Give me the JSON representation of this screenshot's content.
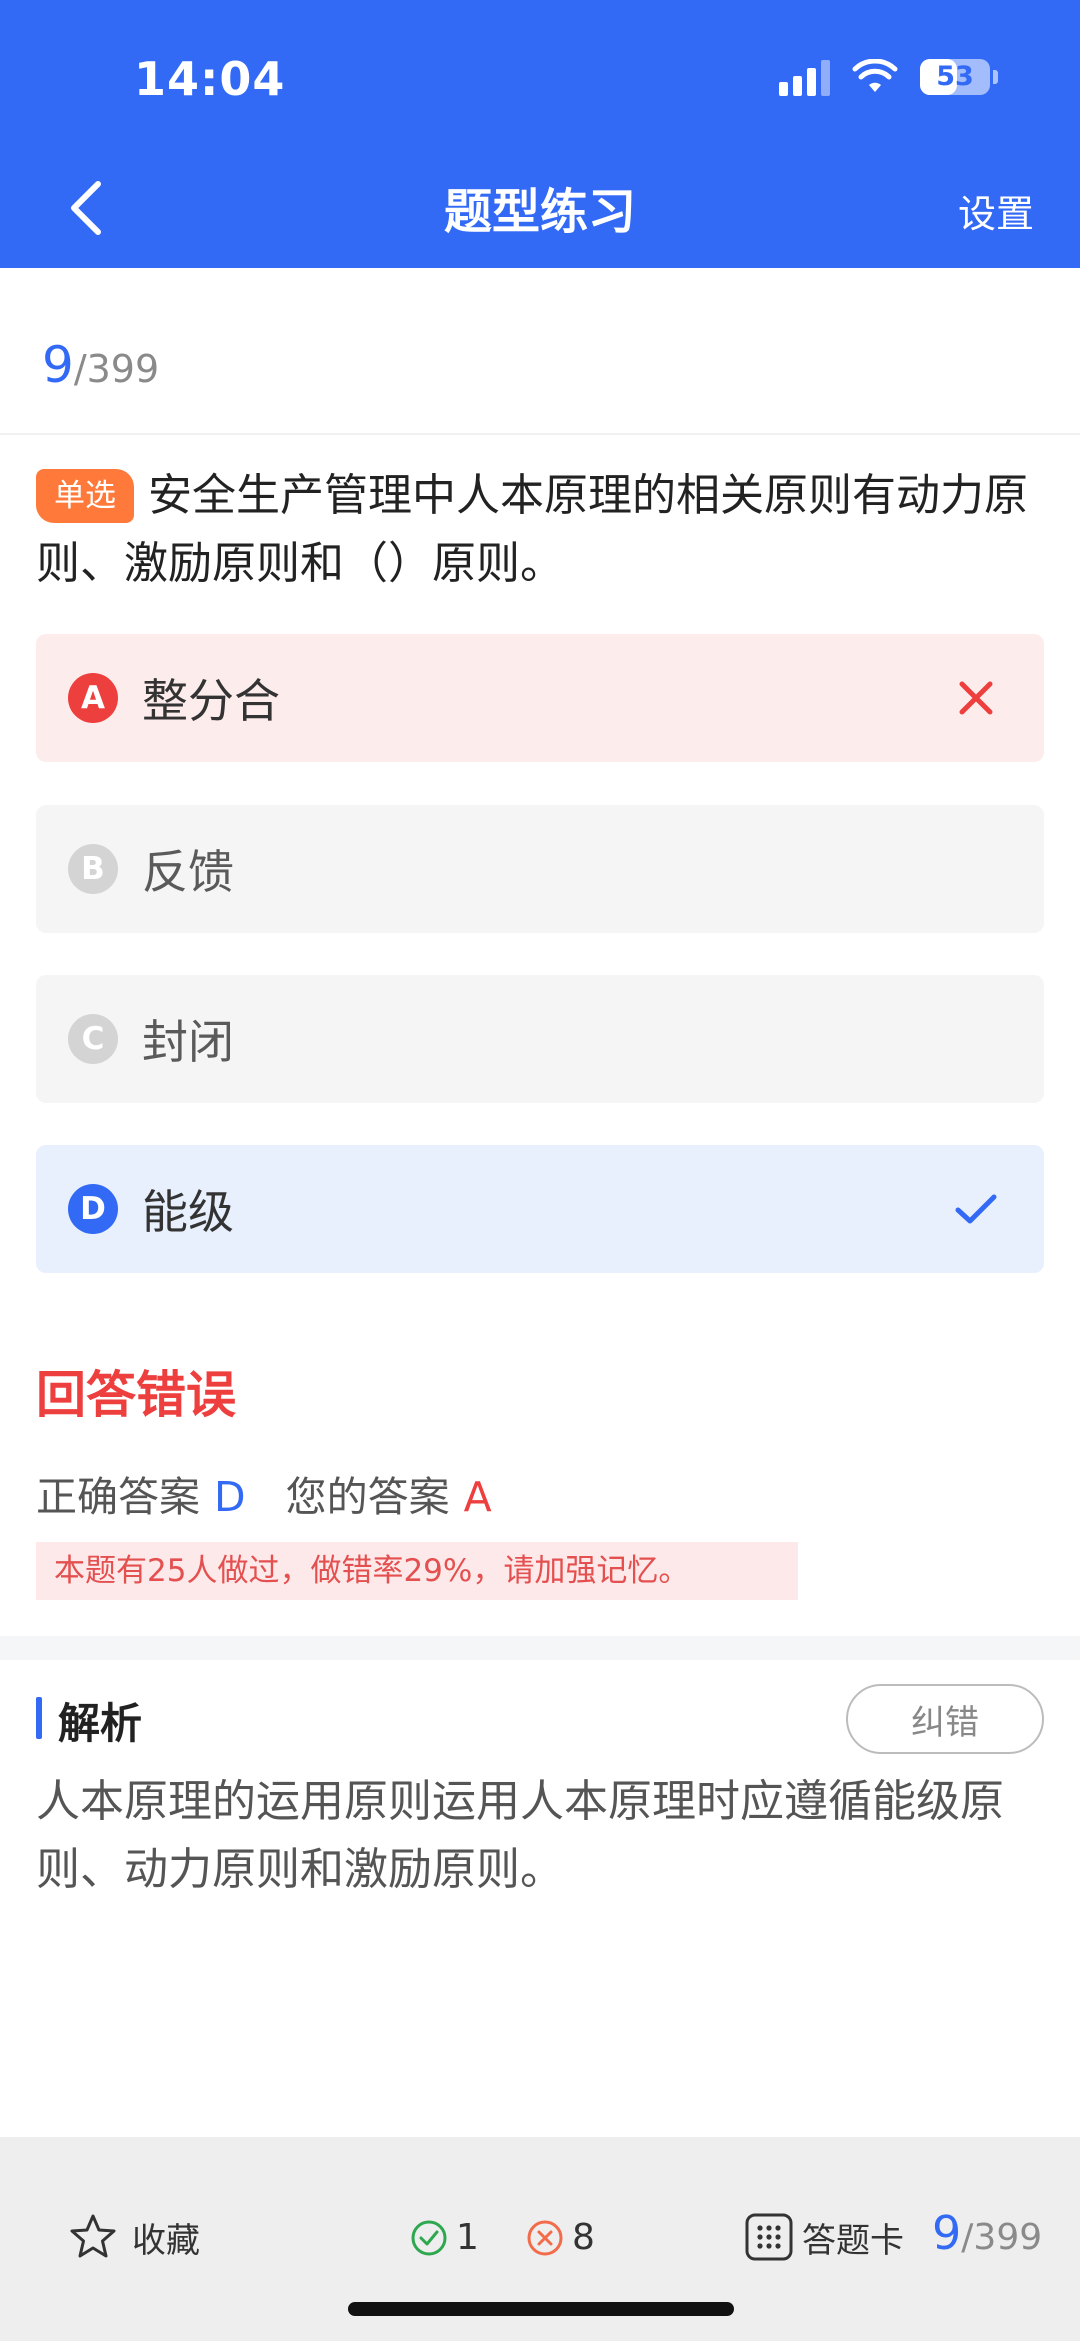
{
  "status_bar": {
    "time": "14:04",
    "battery": "53"
  },
  "nav": {
    "title": "题型练习",
    "settings_label": "设置"
  },
  "progress": {
    "current": "9",
    "total": "/399"
  },
  "question": {
    "tag": "单选",
    "text": "安全生产管理中人本原理的相关原则有动力原则、激励原则和（）原则。"
  },
  "options": [
    {
      "letter": "A",
      "text": "整分合",
      "state": "wrong"
    },
    {
      "letter": "B",
      "text": "反馈",
      "state": "neutral"
    },
    {
      "letter": "C",
      "text": "封闭",
      "state": "neutral"
    },
    {
      "letter": "D",
      "text": "能级",
      "state": "correct"
    }
  ],
  "result": {
    "title": "回答错误",
    "correct_label": "正确答案",
    "correct_value": "D",
    "yours_label": "您的答案",
    "yours_value": "A",
    "stat_text": "本题有25人做过，做错率29%，请加强记忆。"
  },
  "analysis": {
    "title": "解析",
    "report_label": "纠错",
    "text": "人本原理的运用原则运用人本原理时应遵循能级原则、动力原则和激励原则。"
  },
  "bottom": {
    "favorite_label": "收藏",
    "correct_count": "1",
    "wrong_count": "8",
    "card_label": "答题卡",
    "progress_current": "9",
    "progress_total": "/399"
  },
  "colors": {
    "primary": "#336af5",
    "error": "#ee3f3f",
    "tag": "#ff7a3a",
    "correct_green": "#2ea84f",
    "wrong_orange": "#f26b4a"
  },
  "icons": {
    "back": "chevron-left-icon",
    "wrong_mark": "close-icon",
    "correct_mark": "check-icon",
    "favorite": "star-icon",
    "correct_count": "check-circle-icon",
    "wrong_count": "x-circle-icon",
    "answer_card": "grid-icon"
  }
}
